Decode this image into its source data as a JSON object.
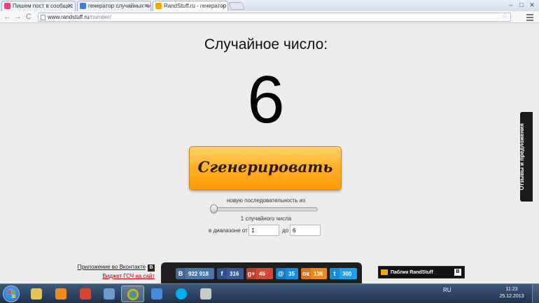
{
  "browser": {
    "tabs": [
      {
        "label": "Пишем пост в сообщес",
        "color": "#e8457a"
      },
      {
        "label": "генератор случайных чи",
        "color": "#4a7bd6"
      },
      {
        "label": "RandStuff.ru - генератор",
        "color": "#f6a800"
      }
    ],
    "nav": {
      "back": "←",
      "forward": "→",
      "reload": "C"
    },
    "url": {
      "host": "www.randstuff.ru",
      "path": "/number/"
    },
    "window_buttons": {
      "minimize": "–",
      "maximize": "□",
      "close": "✕"
    },
    "star": "☆"
  },
  "page": {
    "title": "Случайное число:",
    "result": "6",
    "generate_button": "Сгенерировать",
    "sequence_label": "новую последовательность из",
    "count_label": "1 случайного числа",
    "slider_value": 1,
    "range_from_label": "в диапазоне от",
    "range_from": "1",
    "range_to_label": "до",
    "range_to": "6",
    "feedback_tab": "Отзывы и предложения",
    "vk_app_link": "Приложение во Вконтакте",
    "vk_badge": "В",
    "widget_link": "Виджет ГСЧ на сайт"
  },
  "share": [
    {
      "name": "vk",
      "icon": "В",
      "count": "922 918",
      "color": "#4a76a8"
    },
    {
      "name": "facebook",
      "icon": "f",
      "count": "316",
      "color": "#3b5998"
    },
    {
      "name": "google-plus",
      "icon": "g+",
      "count": "46",
      "color": "#d34836"
    },
    {
      "name": "mail",
      "icon": "@",
      "count": "35",
      "color": "#168de2"
    },
    {
      "name": "odnoklassniki",
      "icon": "ок",
      "count": "136",
      "color": "#f4871c"
    },
    {
      "name": "twitter",
      "icon": "t",
      "count": "300",
      "color": "#1da1f2"
    }
  ],
  "publik": {
    "label": "Паблик RandStuff",
    "badge": "В"
  },
  "taskbar": {
    "apps": [
      {
        "name": "explorer",
        "color": "#e8c35a"
      },
      {
        "name": "media-player",
        "color": "#f08a1c"
      },
      {
        "name": "app3",
        "color": "#d9442e"
      },
      {
        "name": "chrome",
        "color": "#3c9a3c"
      },
      {
        "name": "app5",
        "color": "#4a8ad6"
      },
      {
        "name": "skype",
        "color": "#00aff0"
      },
      {
        "name": "app7",
        "color": "#c9c9c9"
      },
      {
        "name": "app8",
        "color": "#6a9ccf"
      }
    ],
    "lang": "RU",
    "time": "11:23",
    "date": "25.12.2013"
  }
}
